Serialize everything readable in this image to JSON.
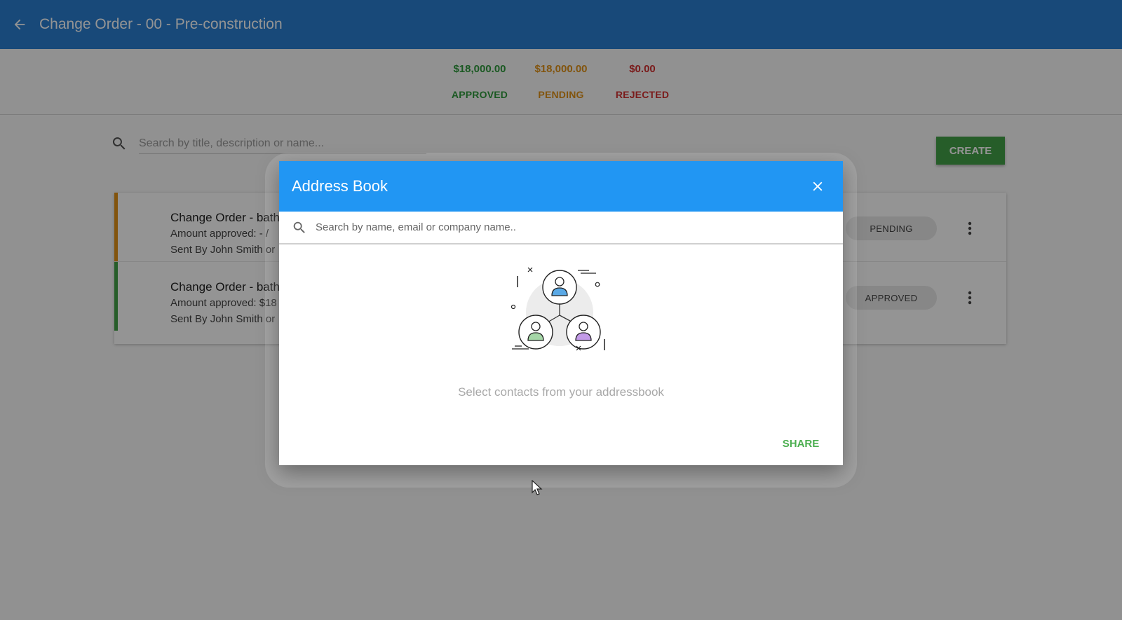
{
  "appbar": {
    "title": "Change Order - 00 - Pre-construction"
  },
  "summary": {
    "approved": {
      "amount": "$18,000.00",
      "label": "APPROVED"
    },
    "pending": {
      "amount": "$18,000.00",
      "label": "PENDING"
    },
    "rejected": {
      "amount": "$0.00",
      "label": "REJECTED"
    }
  },
  "search": {
    "placeholder": "Search by title, description or name..."
  },
  "toolbar": {
    "create_label": "CREATE"
  },
  "colors": {
    "approved": "#2e9a3b",
    "pending": "#e09217",
    "rejected": "#d33030",
    "appbar": "#2a7fd0",
    "dialog_header": "#2196f3"
  },
  "list": {
    "rows": [
      {
        "title": "Change Order - bath",
        "amount": "Amount approved: - /",
        "sent": "Sent By John Smith or",
        "status": "PENDING",
        "status_color": "#e09217"
      },
      {
        "title": "Change Order - bath",
        "amount": "Amount approved: $18",
        "sent": "Sent By John Smith or",
        "status": "APPROVED",
        "status_color": "#43a047"
      }
    ]
  },
  "dialog": {
    "title": "Address Book",
    "search_placeholder": "Search by name, email or company name..",
    "empty_text": "Select contacts from your addressbook",
    "share_label": "SHARE"
  },
  "icons": {
    "back": "arrow-left-icon",
    "search": "magnifier-icon",
    "close": "close-icon",
    "more": "kebab-icon",
    "illustration": "contacts-network-illustration"
  }
}
